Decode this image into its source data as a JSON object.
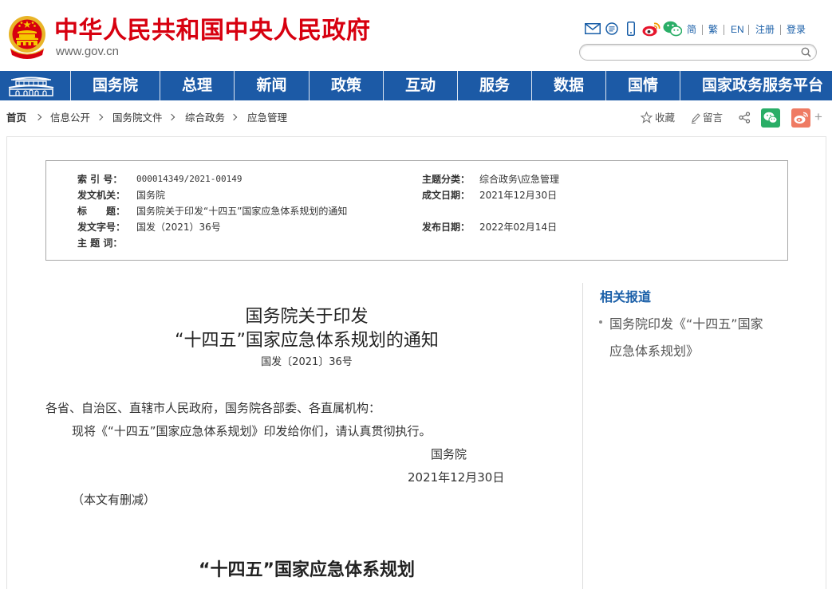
{
  "header": {
    "site_title": "中华人民共和国中央人民政府",
    "domain": "www.gov.cn",
    "icons": [
      "emblem-icon",
      "mail-icon",
      "message-icon",
      "mobile-icon",
      "weibo-icon",
      "wechat-icon",
      "search-icon"
    ],
    "lang": {
      "simplified": "简",
      "traditional": "繁",
      "english": "EN"
    },
    "register": "注册",
    "login": "登录",
    "search": {
      "value": ""
    }
  },
  "nav": {
    "items": [
      "国务院",
      "总理",
      "新闻",
      "政策",
      "互动",
      "服务",
      "数据",
      "国情",
      "国家政务服务平台"
    ]
  },
  "breadcrumb": [
    "首页",
    "信息公开",
    "国务院文件",
    "综合政务",
    "应急管理"
  ],
  "tools": {
    "favorite": "收藏",
    "comment": "留言",
    "more": "+"
  },
  "info": {
    "index_no": {
      "label": "索 引 号：",
      "value": "000014349/2021-00149"
    },
    "category": {
      "label": "主题分类：",
      "value": "综合政务\\应急管理"
    },
    "issuer": {
      "label": "发文机关：",
      "value": "国务院"
    },
    "written_date": {
      "label": "成文日期：",
      "value": "2021年12月30日"
    },
    "title": {
      "label": "标　　题：",
      "value": "国务院关于印发“十四五”国家应急体系规划的通知"
    },
    "doc_no": {
      "label": "发文字号：",
      "value": "国发（2021）36号"
    },
    "publish_date": {
      "label": "发布日期：",
      "value": "2022年02月14日"
    },
    "keywords": {
      "label": "主 题 词：",
      "value": ""
    }
  },
  "article": {
    "title_lines": [
      "国务院关于印发",
      "“十四五”国家应急体系规划的通知"
    ],
    "doc_no": "国发〔2021〕36号",
    "salutation": "各省、自治区、直辖市人民政府，国务院各部委、各直属机构：",
    "body": "现将《“十四五”国家应急体系规划》印发给你们，请认真贯彻执行。",
    "signature": "国务院",
    "date": "2021年12月30日",
    "note": "（本文有删减）",
    "section_title": "“十四五”国家应急体系规划"
  },
  "sidebar": {
    "heading": "相关报道",
    "links": [
      {
        "lines": [
          "国务院印发《“十四五”国家",
          "应急体系规划》"
        ]
      }
    ]
  },
  "colors": {
    "brand_red": "#d7000f",
    "nav_blue": "#1c5aa6",
    "link_blue": "#1a5fa8",
    "wechat_green": "#2aae67",
    "weibo_red": "#ef7b63"
  }
}
